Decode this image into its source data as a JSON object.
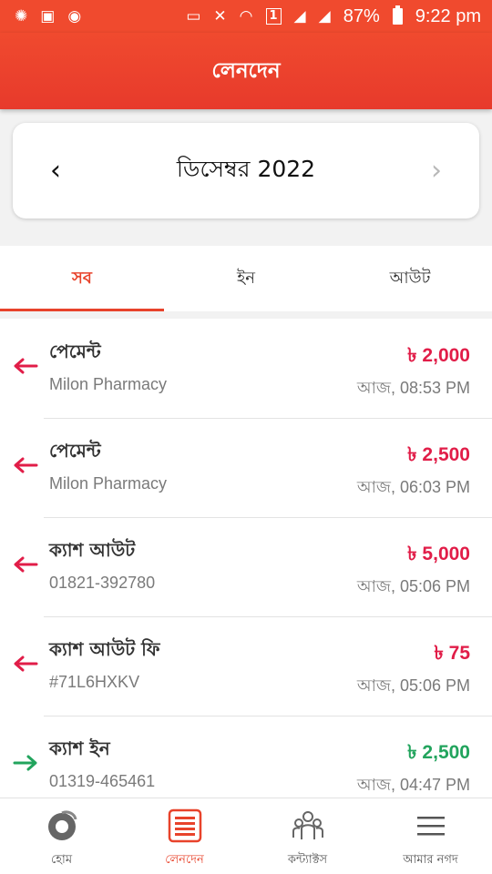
{
  "status_bar": {
    "battery_pct": "87%",
    "time": "9:22 pm",
    "sim_label": "1"
  },
  "header": {
    "title": "লেনদেন"
  },
  "month_selector": {
    "label": "ডিসেম্বর 2022",
    "prev_icon": "‹",
    "next_icon": "›"
  },
  "tabs": [
    {
      "label": "সব",
      "active": true
    },
    {
      "label": "ইন",
      "active": false
    },
    {
      "label": "আউট",
      "active": false
    }
  ],
  "transactions": [
    {
      "title": "পেমেন্ট",
      "subtitle": "Milon Pharmacy",
      "amount": "৳ 2,000",
      "time": "আজ, 08:53 PM",
      "direction": "out"
    },
    {
      "title": "পেমেন্ট",
      "subtitle": "Milon Pharmacy",
      "amount": "৳ 2,500",
      "time": "আজ, 06:03 PM",
      "direction": "out"
    },
    {
      "title": "ক্যাশ আউট",
      "subtitle": "01821-392780",
      "amount": "৳ 5,000",
      "time": "আজ, 05:06 PM",
      "direction": "out"
    },
    {
      "title": "ক্যাশ আউট ফি",
      "subtitle": "#71L6HXKV",
      "amount": "৳ 75",
      "time": "আজ, 05:06 PM",
      "direction": "out"
    },
    {
      "title": "ক্যাশ ইন",
      "subtitle": "01319-465461",
      "amount": "৳ 2,500",
      "time": "আজ, 04:47 PM",
      "direction": "in"
    }
  ],
  "bottom_nav": [
    {
      "label": "হোম",
      "icon": "home-icon",
      "active": false
    },
    {
      "label": "লেনদেন",
      "icon": "transactions-icon",
      "active": true
    },
    {
      "label": "কন্ট্যাক্টস",
      "icon": "contacts-icon",
      "active": false
    },
    {
      "label": "আমার নগদ",
      "icon": "menu-icon",
      "active": false
    }
  ],
  "colors": {
    "brand": "#f04a2e",
    "out_amount": "#e11d48",
    "in_amount": "#22a45d"
  }
}
